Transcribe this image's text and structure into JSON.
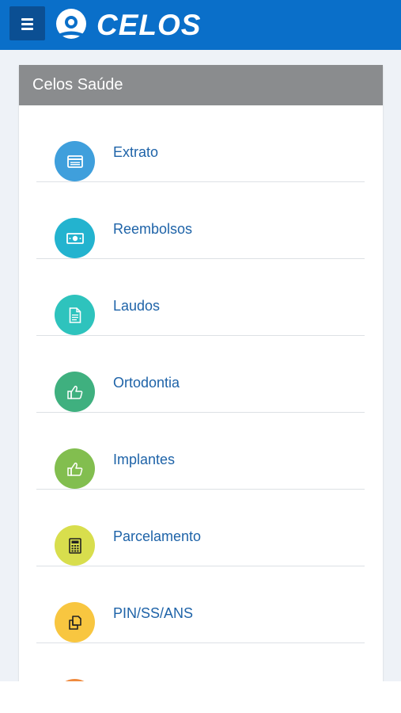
{
  "header": {
    "logo_text": "CELOS",
    "menu_icon": "hamburger-menu-icon",
    "background": "#0a6fc9"
  },
  "section": {
    "title": "Celos Saúde"
  },
  "menu_items": [
    {
      "label": "Extrato",
      "icon": "statement-icon",
      "color": "#3f9fdc"
    },
    {
      "label": "Reembolsos",
      "icon": "money-icon",
      "color": "#23b3cf"
    },
    {
      "label": "Laudos",
      "icon": "document-icon",
      "color": "#2ec3bd"
    },
    {
      "label": "Ortodontia",
      "icon": "thumbs-up-icon",
      "color": "#3fb07f"
    },
    {
      "label": "Implantes",
      "icon": "thumbs-up-icon",
      "color": "#82be4f"
    },
    {
      "label": "Parcelamento",
      "icon": "calculator-icon",
      "color": "#d8de4d"
    },
    {
      "label": "PIN/SS/ANS",
      "icon": "copy-icon",
      "color": "#f8c640"
    },
    {
      "label": "",
      "icon": "",
      "color": "#ef8a3e"
    }
  ]
}
